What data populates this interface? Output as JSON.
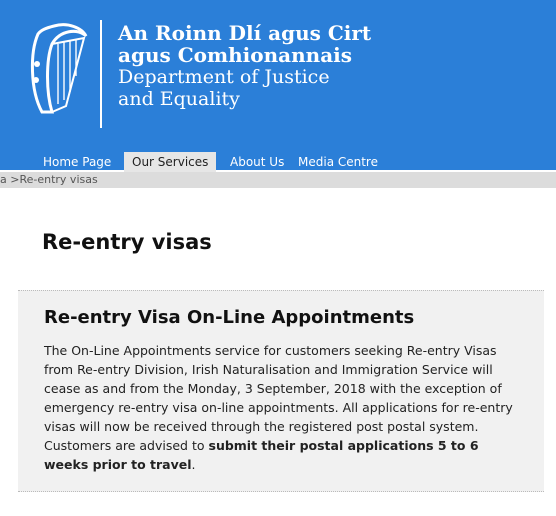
{
  "header": {
    "org_line1": "An Roinn Dlí agus Cirt",
    "org_line2": "agus Comhionannais",
    "org_line3": "Department of Justice",
    "org_line4": "and Equality"
  },
  "nav": {
    "items": [
      {
        "label": "Home Page"
      },
      {
        "label": "Our Services",
        "active": true
      },
      {
        "label": "About Us"
      },
      {
        "label": "Media Centre"
      }
    ]
  },
  "breadcrumb": {
    "prefix": "a > ",
    "current": "Re-entry visas"
  },
  "page": {
    "title": "Re-entry visas"
  },
  "panel": {
    "title": "Re-entry Visa On-Line Appointments",
    "body_text": "The On-Line Appointments service for customers seeking Re-entry Visas from Re-entry Division, Irish Naturalisation and Immigration Service will cease as and from the Monday, 3 September, 2018 with the exception of emergency re-entry visa on-line appointments. All applications for re-entry visas will now be received through the registered post postal system. Customers are advised to ",
    "body_bold": "submit their postal applications 5 to 6 weeks prior to travel",
    "body_end": "."
  },
  "colors": {
    "header_blue": "#2b7fd8",
    "active_tab": "#e6e6e6",
    "panel_bg": "#f1f1f1"
  }
}
